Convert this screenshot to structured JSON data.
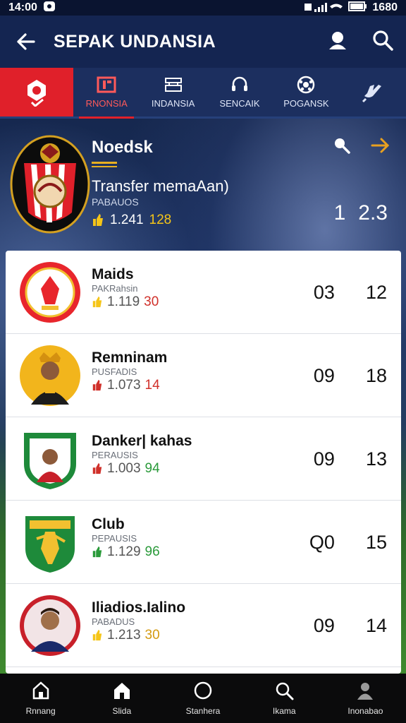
{
  "status_bar": {
    "time": "14:00",
    "battery": "1680"
  },
  "app_bar": {
    "title": "SEPAK UNDANSIA"
  },
  "tabs": [
    {
      "label": "RNONSIA",
      "icon": "building-icon",
      "active": true
    },
    {
      "label": "INDANSIA",
      "icon": "stadium-icon",
      "active": false
    },
    {
      "label": "SENCAIK",
      "icon": "headset-icon",
      "active": false
    },
    {
      "label": "POGANSK",
      "icon": "ball-icon",
      "active": false
    },
    {
      "label": "",
      "icon": "hand-icon",
      "active": false
    }
  ],
  "header": {
    "title": "Noedsk",
    "subtitle": "Transfer memaAan)",
    "meta": "PABAUOS",
    "stat1": "1.241",
    "stat2": "128",
    "score1": "1",
    "score2": "2.3"
  },
  "rows": [
    {
      "name": "Maids",
      "meta": "PAKRahsin",
      "stat1": "1.119",
      "stat2": "30",
      "accent": "#d0302a",
      "score1": "03",
      "score2": "12"
    },
    {
      "name": "Remninam",
      "meta": "PUSFADIS",
      "stat1": "1.073",
      "stat2": "14",
      "accent": "#d0302a",
      "score1": "09",
      "score2": "18"
    },
    {
      "name": "Danker| kahas",
      "meta": "PERAUSIS",
      "stat1": "1.003",
      "stat2": "94",
      "accent": "#2a9a3a",
      "score1": "09",
      "score2": "13"
    },
    {
      "name": "Club",
      "meta": "PEPAUSIS",
      "stat1": "1.129",
      "stat2": "96",
      "accent": "#2a9a3a",
      "score1": "Q0",
      "score2": "15"
    },
    {
      "name": "Iliadios.Ialino",
      "meta": "PABADUS",
      "stat1": "1.213",
      "stat2": "30",
      "accent": "#d49a10",
      "score1": "09",
      "score2": "14"
    }
  ],
  "bottom_nav": [
    {
      "label": "Rnnang",
      "icon": "home-outline-icon"
    },
    {
      "label": "Slida",
      "icon": "home-filled-icon"
    },
    {
      "label": "Stanhera",
      "icon": "circle-icon"
    },
    {
      "label": "Ikama",
      "icon": "search-icon"
    },
    {
      "label": "Inonabao",
      "icon": "profile-icon"
    }
  ]
}
